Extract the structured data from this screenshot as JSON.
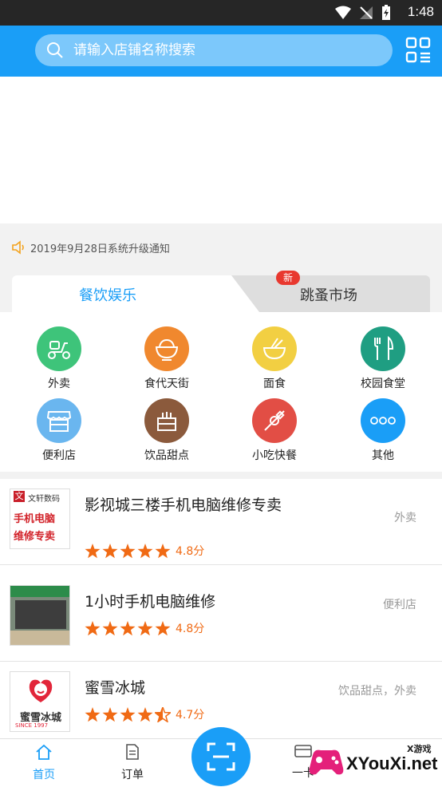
{
  "status_bar": {
    "time": "1:48"
  },
  "search": {
    "placeholder": "请输入店铺名称搜索"
  },
  "notice": {
    "text": "2019年9月28日系统升级通知"
  },
  "tabs": [
    {
      "label": "餐饮娱乐",
      "active": true
    },
    {
      "label": "跳蚤市场",
      "active": false,
      "badge": "新"
    }
  ],
  "categories": [
    {
      "label": "外卖",
      "color": "#3ec47a",
      "icon": "scooter-icon"
    },
    {
      "label": "食代天街",
      "color": "#f0882e",
      "icon": "rice-bowl-icon"
    },
    {
      "label": "面食",
      "color": "#f2cf42",
      "icon": "noodle-bowl-icon"
    },
    {
      "label": "校园食堂",
      "color": "#1f9e82",
      "icon": "fork-knife-icon"
    },
    {
      "label": "便利店",
      "color": "#6ab6ef",
      "icon": "store-icon"
    },
    {
      "label": "饮品甜点",
      "color": "#8b5a3c",
      "icon": "cake-icon"
    },
    {
      "label": "小吃快餐",
      "color": "#e24e45",
      "icon": "skewer-icon"
    },
    {
      "label": "其他",
      "color": "#1a9ef7",
      "icon": "more-dots-icon"
    }
  ],
  "shops": [
    {
      "name": "影视城三楼手机电脑维修专卖",
      "category": "外卖",
      "rating": "4.8分",
      "stars": 5,
      "thumb_text": [
        "文轩数码",
        "手机电脑",
        "维修专卖"
      ]
    },
    {
      "name": "1小时手机电脑维修",
      "category": "便利店",
      "rating": "4.8分",
      "stars": 5
    },
    {
      "name": "蜜雪冰城",
      "category": "饮品甜点，外卖",
      "rating": "4.7分",
      "stars": 4.5,
      "thumb_text": [
        "蜜雪冰城",
        "SINCE 1997"
      ]
    }
  ],
  "bottom_nav": [
    {
      "label": "首页",
      "icon": "home-icon",
      "active": true
    },
    {
      "label": "订单",
      "icon": "order-icon",
      "active": false
    },
    {
      "label": "一卡",
      "icon": "card-icon",
      "active": false
    }
  ],
  "watermark": {
    "small": "X游戏",
    "big": "XYouXi.net"
  },
  "colors": {
    "primary": "#1a9ef7",
    "rating": "#f06a14",
    "badge": "#e8382f"
  }
}
